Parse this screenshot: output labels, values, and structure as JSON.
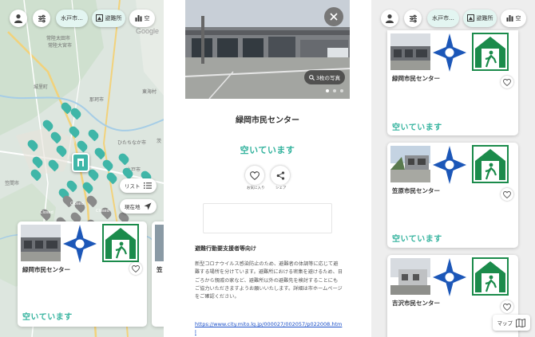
{
  "toolbar": {
    "city_chip": "水戸市...",
    "shelter_chip": "避難所",
    "vacancy_chip": "空"
  },
  "map": {
    "place_labels": [
      "常陸太田市",
      "常陸大宮市",
      "那珂市",
      "城里町",
      "ひたちなか市",
      "東海村",
      "水戸市",
      "笠間市",
      "茨"
    ],
    "google_text": "Google",
    "closed_label": "Closed",
    "list_button": "リスト",
    "location_button": "現在地"
  },
  "map_card": {
    "name": "緑岡市民センター",
    "status": "空いています",
    "peek_name": "笠"
  },
  "detail": {
    "photo_count": "3枚の写真",
    "title": "緑岡市民センター",
    "status": "空いています",
    "favorite_label": "お気に入り",
    "share_label": "シェア",
    "section_heading": "避難行動要支援者等向け",
    "body": "新型コロナウイルス感染防止のため、避難者の体調等に応じて避難する場所を分けています。避難所における密集を避けるため、日ごろから親戚の家など、避難所以外の避難先を検討することにもご協力いただきますようお願いいたします。詳細は市ホームページをご確認ください。",
    "link": "https://www.city.mito.lg.jp/000027/002057/p022008.html"
  },
  "list": {
    "items": [
      {
        "name": "緑岡市民センター",
        "status": "空いています"
      },
      {
        "name": "笠原市民センター",
        "status": "空いています"
      },
      {
        "name": "吉沢市民センター",
        "status": ""
      }
    ],
    "map_button": "マップ"
  },
  "icons": {
    "user": "user-icon",
    "filter": "sliders-icon",
    "shelter": "shelter-icon",
    "vacancy": "bar-chart-icon",
    "heart": "heart-icon",
    "share": "share-icon",
    "close": "close-icon",
    "magnifier": "magnifier-icon",
    "list": "list-icon",
    "navigation": "navigation-arrow-icon",
    "map": "map-icon"
  },
  "colors": {
    "accent": "#34b39e",
    "pin_open": "#3fb6a8",
    "pin_closed": "#8a8a8a",
    "star_blue": "#1c57b8",
    "exit_green": "#1b8b4b",
    "link": "#1a4fc9"
  }
}
